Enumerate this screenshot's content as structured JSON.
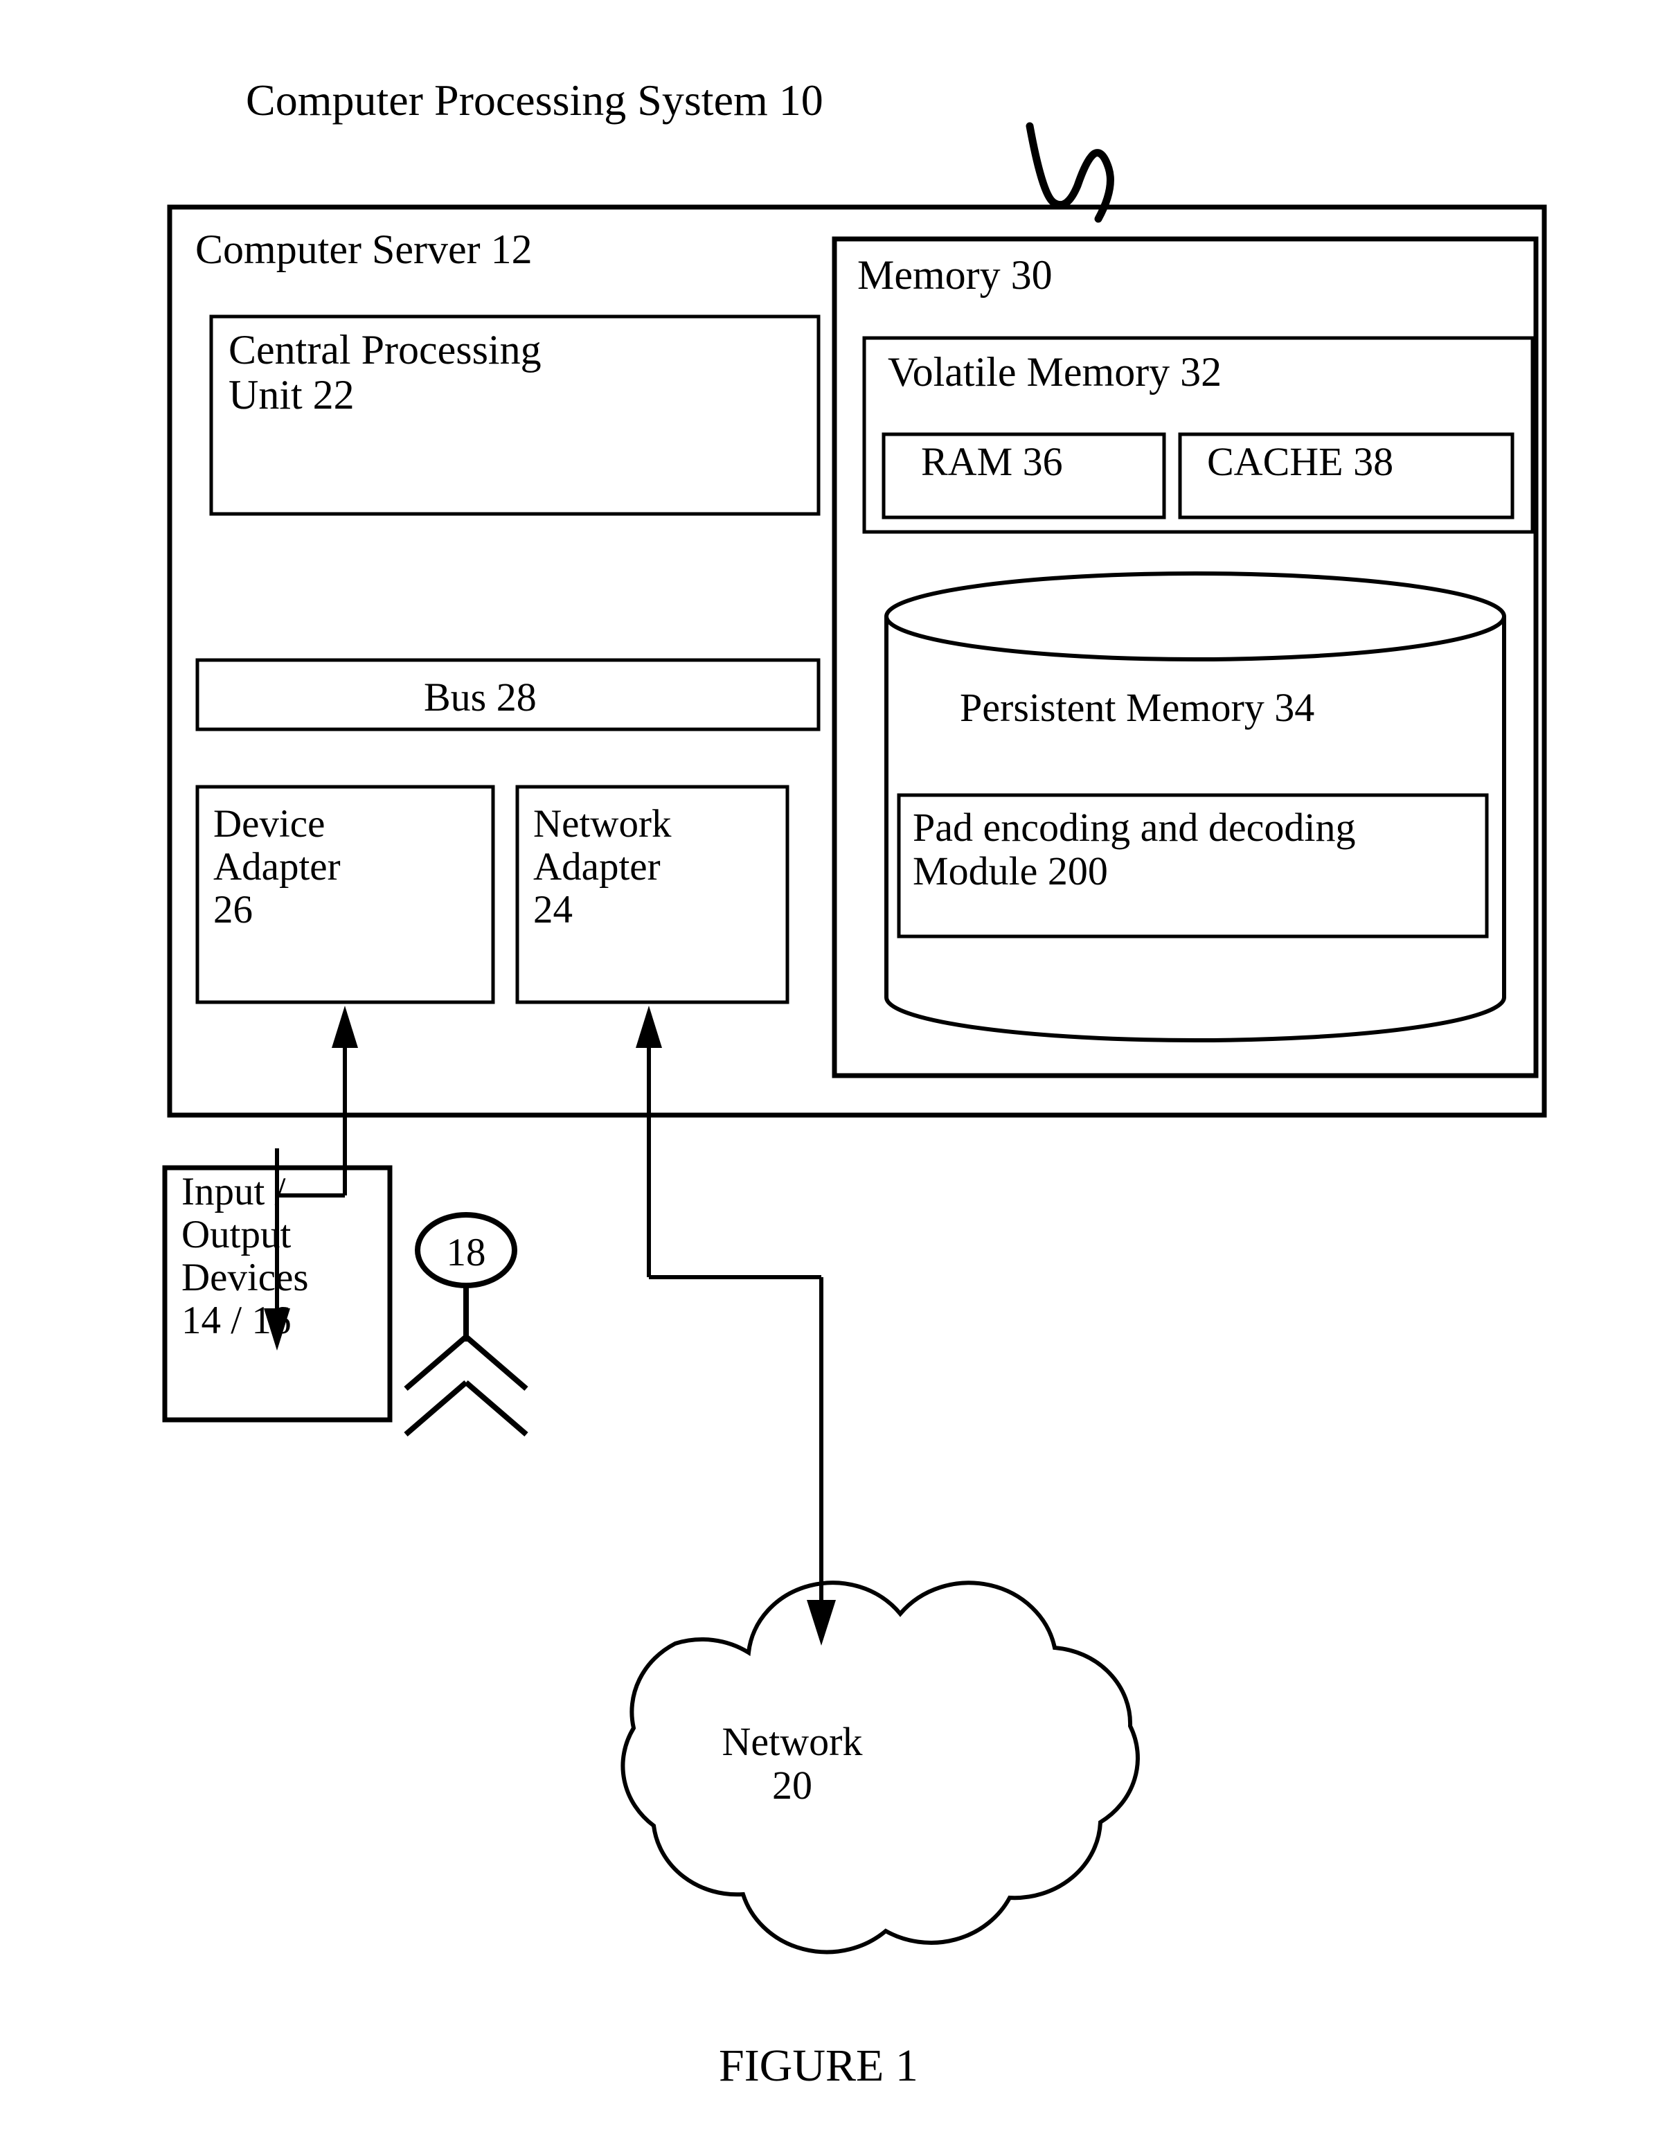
{
  "figure": {
    "title": "Computer Processing System 10",
    "caption": "FIGURE 1"
  },
  "server": {
    "label": "Computer Server 12",
    "cpu": "Central Processing\nUnit 22",
    "bus": "Bus 28",
    "device_adapter": "Device\nAdapter\n26",
    "network_adapter": "Network\nAdapter\n24"
  },
  "memory": {
    "label": "Memory 30",
    "volatile": {
      "label": "Volatile Memory 32",
      "ram": "RAM 36",
      "cache": "CACHE 38"
    },
    "persistent": {
      "label": "Persistent Memory 34",
      "module": "Pad encoding and decoding\nModule 200"
    }
  },
  "io_devices": {
    "label": "Input /\nOutput\nDevices\n14 / 16"
  },
  "user": {
    "reference_number": "18"
  },
  "network": {
    "label": "Network\n20"
  },
  "colors": {
    "ink": "#000000",
    "background": "#ffffff"
  },
  "icons": {
    "stick_figure": "user-stick-figure-icon",
    "cylinder": "database-cylinder-icon",
    "cloud": "network-cloud-icon",
    "squiggle": "leader-squiggle-mark"
  }
}
